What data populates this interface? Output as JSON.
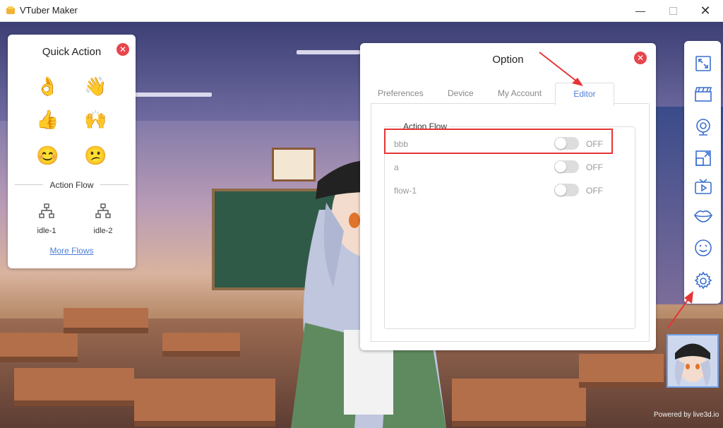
{
  "window": {
    "title": "VTuber Maker",
    "controls": [
      "minimize-icon",
      "maximize-icon",
      "close-icon"
    ]
  },
  "quick_action": {
    "title": "Quick Action",
    "gestures": [
      "👌",
      "👋",
      "👍",
      "🙌",
      "😊",
      "😕"
    ],
    "section_label": "Action Flow",
    "flows": [
      "idle-1",
      "idle-2"
    ],
    "more_flows": "More Flows"
  },
  "option": {
    "title": "Option",
    "tabs": [
      "Preferences",
      "Device",
      "My Account",
      "Editor"
    ],
    "active_tab": "Editor",
    "fieldset_legend": "Action Flow",
    "flows": [
      {
        "name": "bbb",
        "state": "OFF"
      },
      {
        "name": "a",
        "state": "OFF"
      },
      {
        "name": "flow-1",
        "state": "OFF"
      }
    ]
  },
  "toolbar": {
    "tools": [
      "fullscreen-icon",
      "clapperboard-icon",
      "webcam-icon",
      "resize-icon",
      "tv-icon",
      "lips-icon",
      "emoji-face-icon",
      "gear-icon"
    ]
  },
  "footer": {
    "powered": "Powered by live3d.io"
  },
  "colors": {
    "accent": "#4f7fd6",
    "close_red": "#e8454c",
    "annotation_red": "#e53535"
  }
}
